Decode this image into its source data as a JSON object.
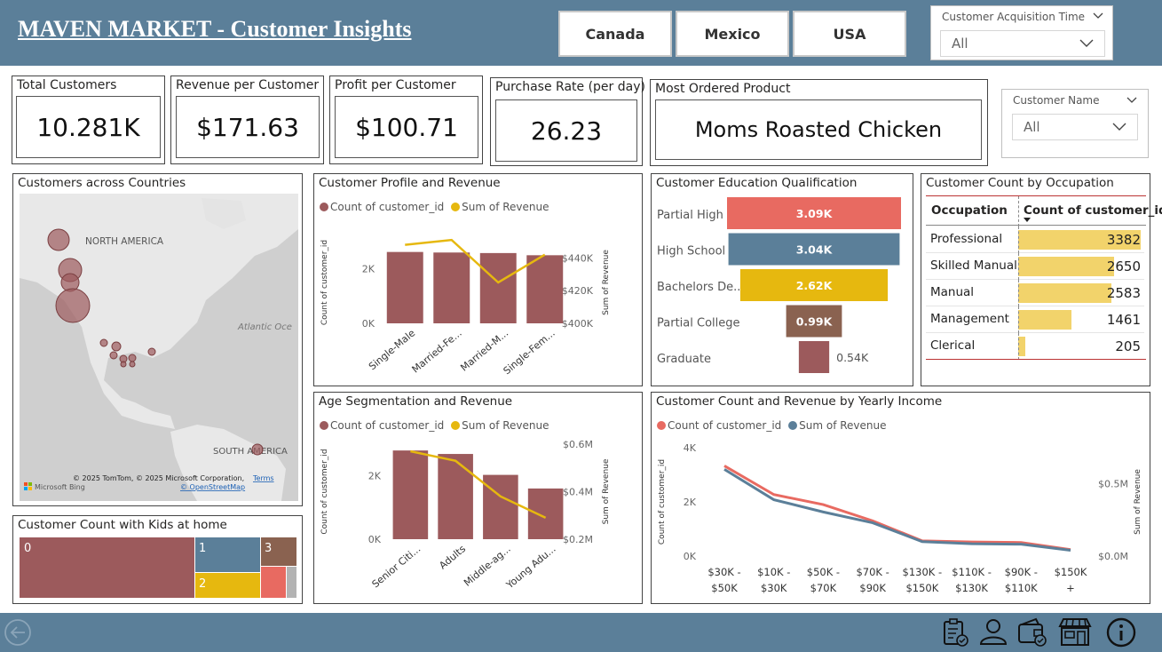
{
  "header": {
    "title": "MAVEN MARKET - Customer Insights",
    "countries": [
      "Canada",
      "Mexico",
      "USA"
    ],
    "acquisition_slicer": {
      "label": "Customer Acquisition Time",
      "value": "All"
    }
  },
  "kpis": {
    "total_customers": {
      "label": "Total Customers",
      "value": "10.281K"
    },
    "revenue_per_customer": {
      "label": "Revenue per Customer",
      "value": "$171.63"
    },
    "profit_per_customer": {
      "label": "Profit per Customer",
      "value": "$100.71"
    },
    "purchase_rate": {
      "label": "Purchase Rate (per day)",
      "value": "26.23"
    },
    "most_ordered": {
      "label": "Most Ordered Product",
      "value": "Moms Roasted Chicken"
    }
  },
  "customer_name_slicer": {
    "label": "Customer Name",
    "value": "All"
  },
  "map": {
    "title": "Customers across Countries",
    "labels": {
      "north_america": "NORTH AMERICA",
      "atlantic": "Atlantic Oce",
      "south_america": "SOUTH AMERICA"
    },
    "attribution": "© 2025 TomTom, © 2025 Microsoft Corporation,",
    "terms": "Terms",
    "osm": "© OpenStreetMap",
    "bing": "Microsoft Bing"
  },
  "kids": {
    "title": "Customer Count with Kids at home",
    "tiles": [
      {
        "label": "0",
        "color": "#9c5a5c"
      },
      {
        "label": "1",
        "color": "#5b7f99"
      },
      {
        "label": "2",
        "color": "#e6b80f"
      },
      {
        "label": "3",
        "color": "#8a6250"
      },
      {
        "label": "",
        "color": "#e86a61"
      },
      {
        "label": "",
        "color": "#b3b3b3"
      }
    ]
  },
  "legends": {
    "count": "Count of customer_id",
    "revenue": "Sum of Revenue",
    "count_color": "#9c5a5c",
    "revenue_color": "#e6b80f",
    "income_count_color": "#e86a61",
    "income_revenue_color": "#5b7f99"
  },
  "chart_data": [
    {
      "id": "profile",
      "type": "bar",
      "title": "Customer Profile and Revenue",
      "categories": [
        "Single-Male",
        "Married-Fe...",
        "Married-M...",
        "Single-Fem..."
      ],
      "series": [
        {
          "name": "Count of customer_id",
          "values": [
            2620,
            2600,
            2580,
            2500
          ]
        },
        {
          "name": "Sum of Revenue",
          "values": [
            448000,
            451000,
            425000,
            442000
          ]
        }
      ],
      "ylabel": "Count of customer_id",
      "y2label": "Sum of Revenue",
      "yticks": [
        "0K",
        "2K"
      ],
      "y2ticks": [
        "$400K",
        "$420K",
        "$440K"
      ],
      "ylim": [
        0,
        3000
      ],
      "y2lim": [
        400000,
        450000
      ]
    },
    {
      "id": "education",
      "type": "bar",
      "title": "Customer Education Qualification",
      "categories": [
        "Partial High S...",
        "High School",
        "Bachelors De...",
        "Partial College",
        "Graduate"
      ],
      "values": [
        3090,
        3040,
        2620,
        990,
        540
      ],
      "labels": [
        "3.09K",
        "3.04K",
        "2.62K",
        "0.99K",
        "0.54K"
      ],
      "colors": [
        "#e86a61",
        "#5b7f99",
        "#e6b80f",
        "#8a6250",
        "#9c5a5c"
      ]
    },
    {
      "id": "occupation",
      "type": "table",
      "title": "Customer Count by Occupation",
      "columns": [
        "Occupation",
        "Count of customer_id"
      ],
      "rows": [
        {
          "name": "Professional",
          "value": 3382
        },
        {
          "name": "Skilled Manual",
          "value": 2650
        },
        {
          "name": "Manual",
          "value": 2583
        },
        {
          "name": "Management",
          "value": 1461
        },
        {
          "name": "Clerical",
          "value": 205
        }
      ]
    },
    {
      "id": "age",
      "type": "bar",
      "title": "Age Segmentation and Revenue",
      "categories": [
        "Senior Citi...",
        "Adults",
        "Middle-ag...",
        "Young Adu..."
      ],
      "series": [
        {
          "name": "Count of customer_id",
          "values": [
            2800,
            2690,
            2030,
            1600
          ]
        },
        {
          "name": "Sum of Revenue",
          "values": [
            570000,
            530000,
            380000,
            290000
          ]
        }
      ],
      "ylabel": "Count of customer_id",
      "y2label": "Sum of Revenue",
      "yticks": [
        "0K",
        "2K"
      ],
      "y2ticks": [
        "$0.2M",
        "$0.4M",
        "$0.6M"
      ],
      "ylim": [
        0,
        3000
      ],
      "y2lim": [
        200000,
        600000
      ]
    },
    {
      "id": "income",
      "type": "line",
      "title": "Customer Count and Revenue by Yearly Income",
      "categories": [
        "$30K - $50K",
        "$10K - $30K",
        "$50K - $70K",
        "$70K - $90K",
        "$130K - $150K",
        "$110K - $130K",
        "$90K - $110K",
        "$150K +"
      ],
      "series": [
        {
          "name": "Count of customer_id",
          "values": [
            3330,
            2270,
            1900,
            1300,
            560,
            520,
            500,
            240
          ]
        },
        {
          "name": "Sum of Revenue",
          "values": [
            0.6,
            0.39,
            0.305,
            0.23,
            0.1,
            0.085,
            0.082,
            0.04
          ]
        }
      ],
      "ylabel": "Count of customer_id",
      "y2label": "Sum of Revenue",
      "yticks": [
        "0K",
        "2K",
        "4K"
      ],
      "y2ticks": [
        "$0.0M",
        "$0.5M"
      ],
      "ylim": [
        0,
        4000
      ],
      "y2lim": [
        0,
        0.75
      ]
    }
  ]
}
